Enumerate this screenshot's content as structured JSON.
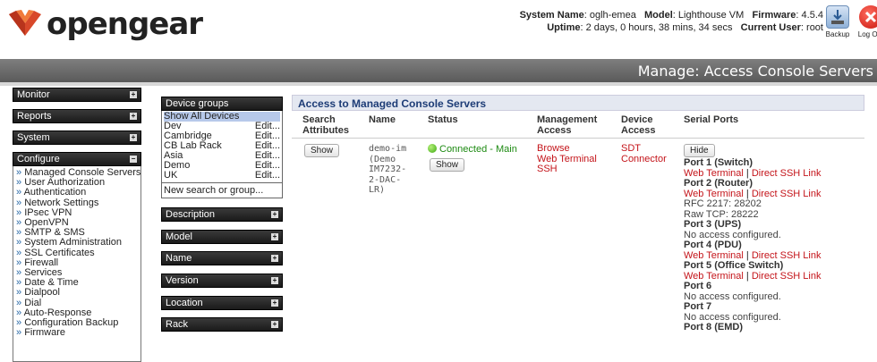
{
  "brand": {
    "name": "opengear"
  },
  "system": {
    "name_label": "System Name",
    "name": "oglh-emea",
    "model_label": "Model",
    "model": "Lighthouse VM",
    "firmware_label": "Firmware",
    "firmware": "4.5.4",
    "uptime_label": "Uptime",
    "uptime": "2 days, 0 hours, 38 mins, 34 secs",
    "user_label": "Current User",
    "user": "root"
  },
  "header_buttons": {
    "backup": "Backup",
    "logout": "Log Out"
  },
  "page_title": "Manage: Access Console Servers",
  "nav": {
    "monitor": "Monitor",
    "reports": "Reports",
    "system": "System",
    "configure": "Configure",
    "configure_items": [
      "Managed Console Servers",
      "User Authorization",
      "Authentication",
      "Network Settings",
      "IPsec VPN",
      "OpenVPN",
      "SMTP & SMS",
      "System Administration",
      "SSL Certificates",
      "Firewall",
      "Services",
      "Date & Time",
      "Dialpool",
      "Dial",
      "Auto-Response",
      "Configuration Backup",
      "Firmware"
    ]
  },
  "filters": {
    "device_groups": "Device groups",
    "groups": [
      {
        "name": "Show All Devices",
        "edit": ""
      },
      {
        "name": "Dev",
        "edit": "Edit..."
      },
      {
        "name": "Cambridge",
        "edit": "Edit..."
      },
      {
        "name": "CB Lab Rack",
        "edit": "Edit..."
      },
      {
        "name": "Asia",
        "edit": "Edit..."
      },
      {
        "name": "Demo",
        "edit": "Edit..."
      },
      {
        "name": "UK",
        "edit": "Edit..."
      }
    ],
    "new_search": "New search or group...",
    "sections": [
      "Description",
      "Model",
      "Name",
      "Version",
      "Location",
      "Rack"
    ]
  },
  "table": {
    "title": "Access to Managed Console Servers",
    "headers": {
      "search1": "Search",
      "search2": "Attributes",
      "name": "Name",
      "status": "Status",
      "mgmt1": "Management",
      "mgmt2": "Access",
      "dev1": "Device",
      "dev2": "Access",
      "serial": "Serial Ports"
    },
    "row": {
      "show_btn": "Show",
      "name_lines": [
        "demo-im",
        "(Demo",
        "IM7232-",
        "2-DAC-",
        "LR)"
      ],
      "status": "Connected - Main",
      "status_btn": "Show",
      "mgmt": [
        "Browse",
        "Web Terminal",
        "SSH"
      ],
      "device": [
        "SDT",
        "Connector"
      ],
      "hide_btn": "Hide",
      "web_terminal": "Web Terminal",
      "sep": " | ",
      "ssh_link": "Direct SSH Link",
      "port1": "Port 1 (Switch)",
      "port2": "Port 2 (Router)",
      "rfc": "RFC 2217: 28202",
      "raw": "Raw TCP: 28222",
      "port3": "Port 3 (UPS)",
      "no_access": "No access configured.",
      "port4": "Port 4 (PDU)",
      "port5": "Port 5 (Office Switch)",
      "port6": "Port 6",
      "port7": "Port 7",
      "port8": "Port 8 (EMD)"
    }
  }
}
